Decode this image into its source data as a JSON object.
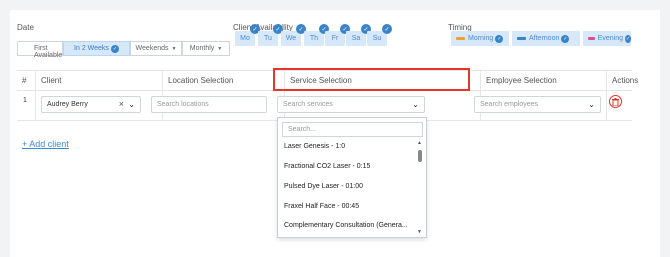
{
  "filters": {
    "date_label": "Date",
    "date_options": [
      {
        "label": "First Available"
      },
      {
        "label": "In 2 Weeks"
      },
      {
        "label": "Weekends"
      },
      {
        "label": "Monthly"
      }
    ],
    "availability_label": "Client Availability",
    "days": [
      "Mo",
      "Tu",
      "We",
      "Th",
      "Fr",
      "Sa",
      "Su"
    ],
    "timing_label": "Timing",
    "timing_options": [
      {
        "label": "Morning",
        "color": "#f0a030"
      },
      {
        "label": "Afternoon",
        "color": "#3a83c9"
      },
      {
        "label": "Evening",
        "color": "#e24c8f"
      }
    ]
  },
  "table": {
    "headers": {
      "index": "#",
      "client": "Client",
      "location": "Location Selection",
      "service": "Service Selection",
      "employee": "Employee Selection",
      "actions": "Actions"
    },
    "row": {
      "index": "1",
      "client": "Audrey Berry",
      "clear_glyph": "×",
      "location_placeholder": "Search locations",
      "service_placeholder": "Search services",
      "employee_placeholder": "Search employees"
    }
  },
  "dropdown": {
    "search_placeholder": "Search...",
    "items": [
      "Laser Genesis - 1:0",
      "Fractional CO2 Laser - 0:15",
      "Pulsed Dye Laser - 01:00",
      "Fraxel Half Face - 00:45",
      "Complementary Consultation (Genera..."
    ]
  },
  "add_client_label": "+ Add client"
}
